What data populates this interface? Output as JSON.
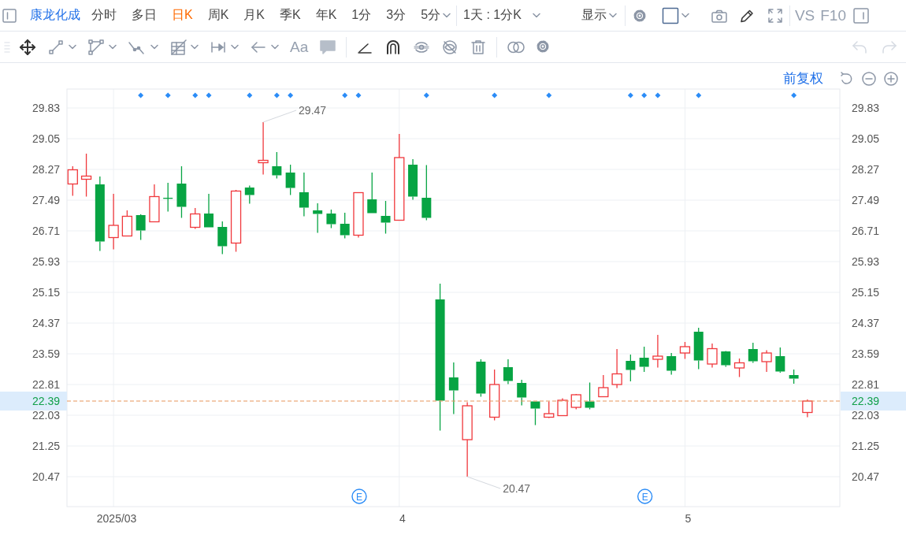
{
  "toolbar": {
    "stock_name": "康龙化成",
    "periods": [
      {
        "label": "分时",
        "selected": false,
        "dropdown": false
      },
      {
        "label": "多日",
        "selected": false,
        "dropdown": false
      },
      {
        "label": "日K",
        "selected": true,
        "dropdown": false
      },
      {
        "label": "周K",
        "selected": false,
        "dropdown": false
      },
      {
        "label": "月K",
        "selected": false,
        "dropdown": false
      },
      {
        "label": "季K",
        "selected": false,
        "dropdown": false
      },
      {
        "label": "年K",
        "selected": false,
        "dropdown": false
      },
      {
        "label": "1分",
        "selected": false,
        "dropdown": false
      },
      {
        "label": "3分",
        "selected": false,
        "dropdown": false
      },
      {
        "label": "5分",
        "selected": false,
        "dropdown": true
      }
    ],
    "interval": "1天 : 1分K",
    "display_menu": "显示",
    "compare": "VS",
    "f10": "F10"
  },
  "drawing_toolbar": {
    "text_tool": "Aa",
    "undo_enabled": false,
    "redo_enabled": false
  },
  "chart": {
    "adjustment": "前复权",
    "left_axis_labels": [
      "29.83",
      "29.05",
      "28.27",
      "27.49",
      "26.71",
      "25.93",
      "25.15",
      "24.37",
      "23.59",
      "22.81",
      "22.03",
      "21.25",
      "20.47"
    ],
    "right_axis_labels": [
      "29.83",
      "29.05",
      "28.27",
      "27.49",
      "26.71",
      "25.93",
      "25.15",
      "24.37",
      "23.59",
      "22.81",
      "22.03",
      "21.25",
      "20.47"
    ],
    "last_price_labels": [
      "22.39",
      "22.39"
    ],
    "signals": [
      {
        "marked": false,
        "event": false
      },
      {
        "marked": false,
        "event": false
      },
      {
        "marked": false,
        "event": false
      },
      {
        "marked": false,
        "event": false
      },
      {
        "marked": false,
        "event": false
      },
      {
        "marked": true,
        "event": false
      },
      {
        "marked": false,
        "event": false
      },
      {
        "marked": true,
        "event": false
      },
      {
        "marked": false,
        "event": false
      },
      {
        "marked": true,
        "event": false
      },
      {
        "marked": true,
        "event": false
      },
      {
        "marked": false,
        "event": false
      },
      {
        "marked": false,
        "event": false
      },
      {
        "marked": true,
        "event": false
      },
      {
        "marked": false,
        "event": false
      },
      {
        "marked": true,
        "event": false
      },
      {
        "marked": true,
        "event": false
      },
      {
        "marked": false,
        "event": false
      },
      {
        "marked": false,
        "event": false
      },
      {
        "marked": false,
        "event": false
      },
      {
        "marked": true,
        "event": false
      },
      {
        "marked": true,
        "event": true
      },
      {
        "marked": false,
        "event": false
      },
      {
        "marked": false,
        "event": false
      },
      {
        "marked": false,
        "event": false
      },
      {
        "marked": false,
        "event": false
      },
      {
        "marked": true,
        "event": false
      },
      {
        "marked": false,
        "event": false
      },
      {
        "marked": false,
        "event": false
      },
      {
        "marked": false,
        "event": false
      },
      {
        "marked": false,
        "event": false
      },
      {
        "marked": true,
        "event": false
      },
      {
        "marked": false,
        "event": false
      },
      {
        "marked": false,
        "event": false
      },
      {
        "marked": false,
        "event": false
      },
      {
        "marked": true,
        "event": false
      },
      {
        "marked": false,
        "event": false
      },
      {
        "marked": false,
        "event": false
      },
      {
        "marked": false,
        "event": false
      },
      {
        "marked": false,
        "event": false
      },
      {
        "marked": false,
        "event": false
      },
      {
        "marked": true,
        "event": false
      },
      {
        "marked": true,
        "event": true
      },
      {
        "marked": true,
        "event": false
      },
      {
        "marked": false,
        "event": false
      },
      {
        "marked": false,
        "event": false
      },
      {
        "marked": true,
        "event": false
      },
      {
        "marked": false,
        "event": false
      },
      {
        "marked": false,
        "event": false
      },
      {
        "marked": false,
        "event": false
      },
      {
        "marked": false,
        "event": false
      },
      {
        "marked": false,
        "event": false
      },
      {
        "marked": false,
        "event": false
      },
      {
        "marked": true,
        "event": false
      },
      {
        "marked": false,
        "event": false
      }
    ],
    "chart_data": {
      "type": "candlestick",
      "grid": true,
      "ylim": [
        19.71,
        30.31
      ],
      "yticks": [
        29.83,
        29.05,
        28.27,
        27.49,
        26.71,
        25.93,
        25.15,
        24.37,
        23.59,
        22.81,
        22.03,
        21.25,
        20.47
      ],
      "categories": [
        null,
        null,
        null,
        "2025/03",
        null,
        null,
        null,
        null,
        null,
        null,
        null,
        null,
        null,
        null,
        null,
        null,
        null,
        null,
        null,
        null,
        null,
        null,
        null,
        null,
        "4",
        null,
        null,
        null,
        null,
        null,
        null,
        null,
        null,
        null,
        null,
        null,
        null,
        null,
        null,
        null,
        null,
        null,
        null,
        null,
        null,
        "5",
        null,
        null,
        null,
        null,
        null,
        null,
        null,
        null,
        null
      ],
      "ohlc": [
        [
          27.9,
          28.35,
          27.6,
          28.26
        ],
        [
          28.02,
          28.67,
          27.58,
          28.1
        ],
        [
          27.89,
          28.09,
          26.2,
          26.44
        ],
        [
          26.54,
          27.65,
          26.24,
          26.85
        ],
        [
          26.58,
          27.23,
          26.58,
          27.08
        ],
        [
          27.11,
          27.13,
          26.48,
          26.72
        ],
        [
          26.94,
          27.89,
          26.94,
          27.58
        ],
        [
          27.55,
          27.93,
          27.2,
          27.54
        ],
        [
          27.91,
          28.35,
          27.04,
          27.32
        ],
        [
          26.8,
          27.29,
          26.76,
          27.14
        ],
        [
          27.15,
          27.65,
          26.8,
          26.8
        ],
        [
          26.81,
          26.95,
          26.12,
          26.32
        ],
        [
          26.4,
          27.75,
          26.18,
          27.72
        ],
        [
          27.81,
          27.86,
          27.4,
          27.62
        ],
        [
          28.44,
          29.47,
          28.14,
          28.5
        ],
        [
          28.35,
          28.71,
          28.04,
          28.12
        ],
        [
          28.19,
          28.39,
          27.62,
          27.8
        ],
        [
          27.69,
          28.19,
          27.08,
          27.3
        ],
        [
          27.23,
          27.41,
          26.66,
          27.14
        ],
        [
          27.15,
          27.25,
          26.78,
          26.88
        ],
        [
          26.89,
          27.17,
          26.52,
          26.6
        ],
        [
          26.6,
          27.68,
          26.54,
          27.68
        ],
        [
          27.51,
          28.19,
          27.16,
          27.16
        ],
        [
          27.09,
          27.47,
          26.64,
          26.92
        ],
        [
          26.98,
          29.17,
          26.98,
          28.57
        ],
        [
          28.39,
          28.53,
          27.5,
          27.58
        ],
        [
          27.55,
          28.38,
          26.98,
          27.04
        ],
        [
          24.97,
          25.37,
          21.64,
          22.4
        ],
        [
          22.99,
          23.37,
          22.06,
          22.66
        ],
        [
          21.41,
          22.36,
          20.47,
          22.27
        ],
        [
          23.39,
          23.45,
          22.5,
          22.58
        ],
        [
          21.98,
          23.19,
          21.9,
          22.81
        ],
        [
          23.25,
          23.45,
          22.82,
          22.9
        ],
        [
          22.85,
          22.93,
          22.28,
          22.48
        ],
        [
          22.38,
          22.38,
          21.78,
          22.2
        ],
        [
          21.98,
          22.38,
          21.96,
          22.07
        ],
        [
          22.02,
          22.46,
          22.02,
          22.41
        ],
        [
          22.23,
          22.57,
          22.18,
          22.55
        ],
        [
          22.38,
          22.86,
          22.18,
          22.22
        ],
        [
          22.5,
          23.05,
          22.5,
          22.73
        ],
        [
          22.81,
          23.71,
          22.72,
          23.08
        ],
        [
          23.41,
          23.57,
          22.89,
          23.18
        ],
        [
          23.49,
          23.77,
          23.13,
          23.26
        ],
        [
          23.45,
          24.07,
          23.24,
          23.53
        ],
        [
          23.53,
          23.61,
          23.06,
          23.16
        ],
        [
          23.61,
          23.89,
          23.46,
          23.77
        ],
        [
          24.15,
          24.25,
          23.2,
          23.42
        ],
        [
          23.33,
          23.85,
          23.24,
          23.72
        ],
        [
          23.65,
          23.66,
          23.26,
          23.3
        ],
        [
          23.23,
          23.47,
          23.0,
          23.36
        ],
        [
          23.71,
          23.87,
          23.36,
          23.4
        ],
        [
          23.39,
          23.68,
          23.13,
          23.61
        ],
        [
          23.53,
          23.75,
          23.11,
          23.14
        ],
        [
          23.05,
          23.19,
          22.83,
          22.96
        ],
        [
          22.1,
          22.43,
          21.98,
          22.39
        ]
      ],
      "ref_lines": [
        {
          "axis": "y",
          "value": 22.39
        }
      ],
      "annotations": [
        "29.47",
        "20.47",
        "E",
        "E"
      ]
    }
  }
}
